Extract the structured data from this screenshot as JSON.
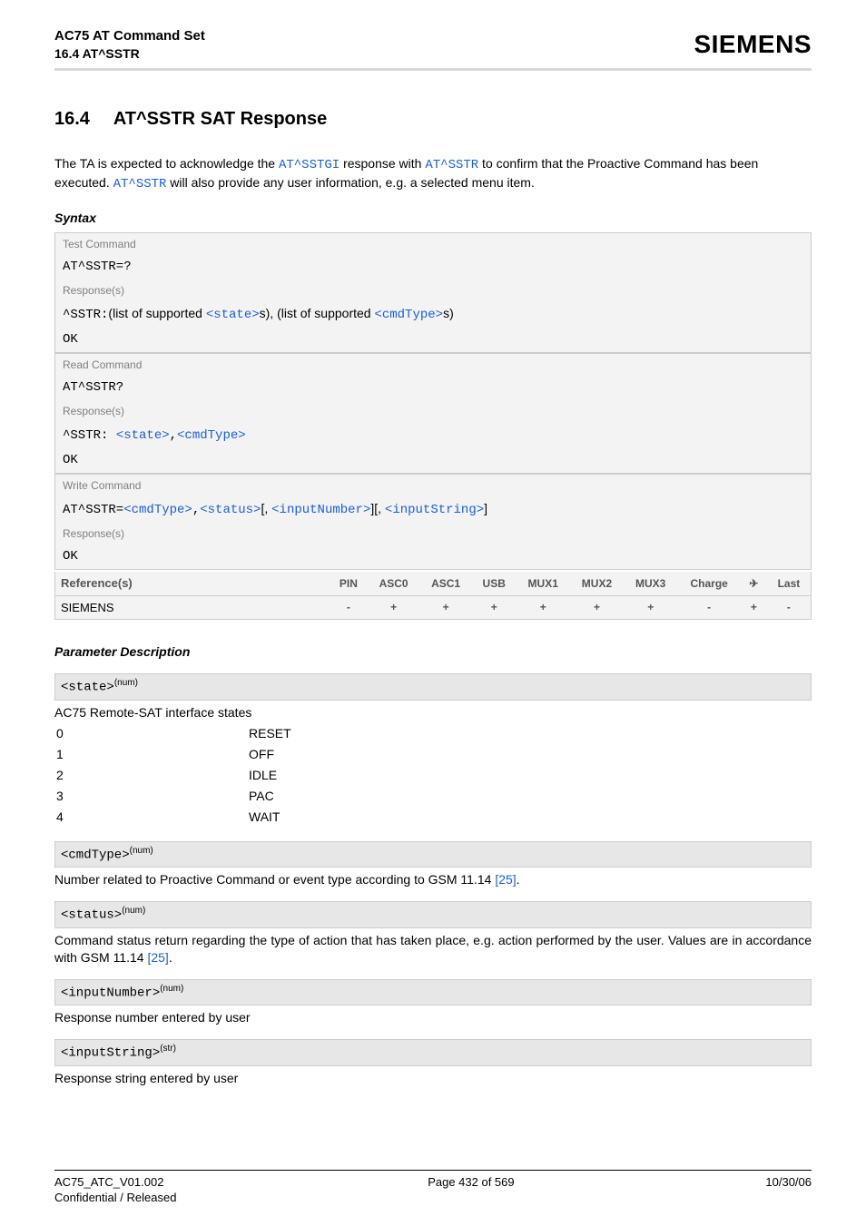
{
  "header": {
    "title": "AC75 AT Command Set",
    "subtitle": "16.4 AT^SSTR",
    "brand": "SIEMENS"
  },
  "section": {
    "number": "16.4",
    "title": "AT^SSTR   SAT Response"
  },
  "intro": {
    "p1a": "The TA is expected to acknowledge the ",
    "p1_link1": "AT^SSTGI",
    "p1b": " response with ",
    "p1_link2": "AT^SSTR",
    "p1c": " to confirm that the Proactive Command has been executed. ",
    "p1_link3": "AT^SSTR",
    "p1d": " will also provide any user information, e.g. a selected menu item."
  },
  "syntax_heading": "Syntax",
  "box": {
    "test_label": "Test Command",
    "test_cmd": "AT^SSTR=?",
    "resp_label": "Response(s)",
    "test_resp_prefix": "^SSTR:",
    "test_resp_mid1": "(list of supported ",
    "test_resp_state": "<state>",
    "test_resp_mid2": "s), (list of supported ",
    "test_resp_cmdtype": "<cmdType>",
    "test_resp_mid3": "s)",
    "ok": "OK",
    "read_label": "Read Command",
    "read_cmd": "AT^SSTR?",
    "read_resp_prefix": "^SSTR: ",
    "read_resp_state": "<state>",
    "read_resp_sep": ",",
    "read_resp_cmdtype": "<cmdType>",
    "write_label": "Write Command",
    "write_cmd_prefix": "AT^SSTR=",
    "write_cmdtype": "<cmdType>",
    "write_sep1": ",",
    "write_status": "<status>",
    "write_sep2": "[, ",
    "write_inputnum": "<inputNumber>",
    "write_sep3": "][, ",
    "write_inputstr": "<inputString>",
    "write_sep4": "]",
    "ref_label": "Reference(s)",
    "cols": [
      "PIN",
      "ASC0",
      "ASC1",
      "USB",
      "MUX1",
      "MUX2",
      "MUX3",
      "Charge",
      "✈",
      "Last"
    ],
    "ref_value_label": "SIEMENS",
    "ref_values": [
      "-",
      "+",
      "+",
      "+",
      "+",
      "+",
      "+",
      "-",
      "+",
      "-"
    ]
  },
  "param_heading": "Parameter Description",
  "params": {
    "state_name": "<state>",
    "state_sup": "(num)",
    "state_desc": "AC75 Remote-SAT interface states",
    "state_rows": [
      {
        "k": "0",
        "v": "RESET"
      },
      {
        "k": "1",
        "v": "OFF"
      },
      {
        "k": "2",
        "v": "IDLE"
      },
      {
        "k": "3",
        "v": "PAC"
      },
      {
        "k": "4",
        "v": "WAIT"
      }
    ],
    "cmdtype_name": "<cmdType>",
    "cmdtype_sup": "(num)",
    "cmdtype_desc_a": "Number related to Proactive Command or event type according to GSM 11.14 ",
    "cmdtype_desc_link": "[25]",
    "cmdtype_desc_b": ".",
    "status_name": "<status>",
    "status_sup": "(num)",
    "status_desc_a": "Command status return regarding the type of action that has taken place, e.g. action performed by the user. Values are in accordance with GSM 11.14 ",
    "status_desc_link": "[25]",
    "status_desc_b": ".",
    "inputnum_name": "<inputNumber>",
    "inputnum_sup": "(num)",
    "inputnum_desc": "Response number entered by user",
    "inputstr_name": "<inputString>",
    "inputstr_sup": "(str)",
    "inputstr_desc": "Response string entered by user"
  },
  "footer": {
    "left1": "AC75_ATC_V01.002",
    "left2": "Confidential / Released",
    "mid": "Page 432 of 569",
    "right": "10/30/06"
  }
}
